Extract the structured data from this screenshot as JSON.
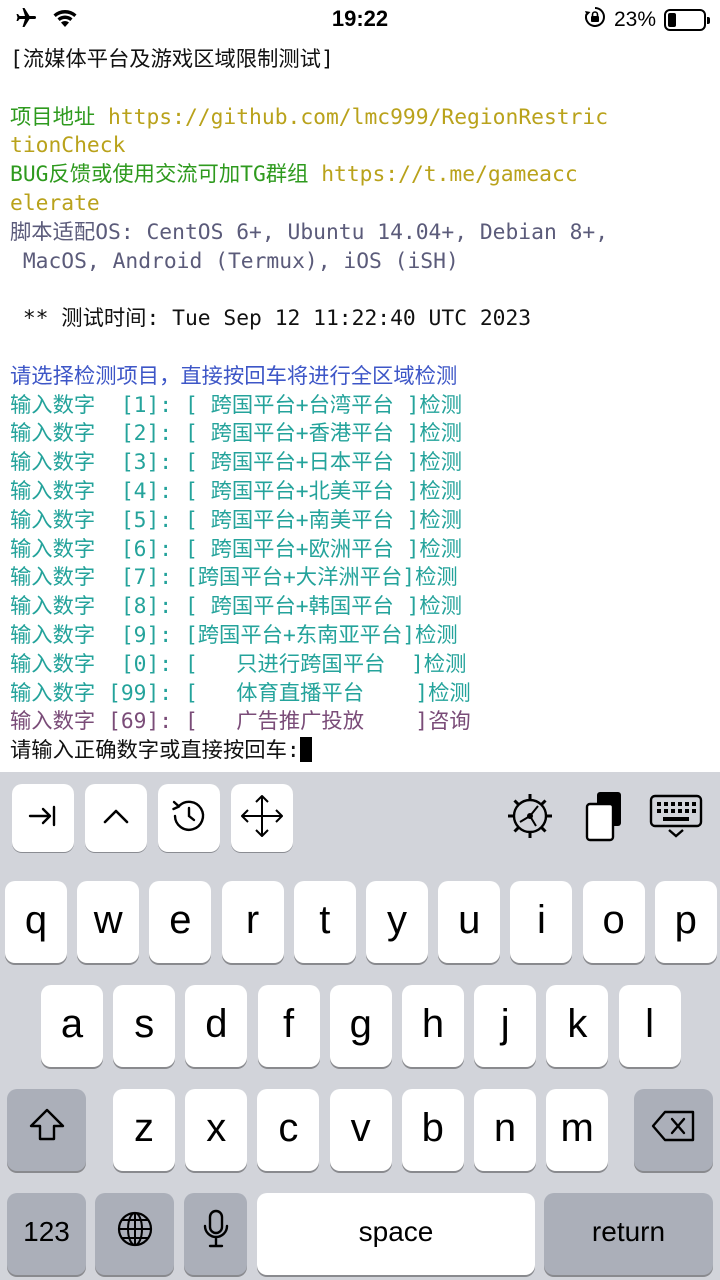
{
  "status_bar": {
    "time": "19:22",
    "battery_percent": "23%",
    "battery_level": 0.23,
    "icons": [
      "airplane-icon",
      "wifi-icon",
      "rotation-lock-icon",
      "battery-icon"
    ]
  },
  "terminal": {
    "lines": [
      {
        "segments": [
          {
            "text": "[流媒体平台及游戏区域限制测试]",
            "color": "black"
          }
        ]
      },
      {
        "segments": [
          {
            "text": "",
            "color": "black"
          }
        ]
      },
      {
        "segments": [
          {
            "text": "项目地址 ",
            "color": "green"
          },
          {
            "text": "https://github.com/lmc999/RegionRestric",
            "color": "yellow"
          }
        ]
      },
      {
        "segments": [
          {
            "text": "tionCheck",
            "color": "yellow"
          }
        ]
      },
      {
        "segments": [
          {
            "text": "BUG反馈或使用交流可加TG群组 ",
            "color": "green"
          },
          {
            "text": "https://t.me/gameacc",
            "color": "yellow"
          }
        ]
      },
      {
        "segments": [
          {
            "text": "elerate",
            "color": "yellow"
          }
        ]
      },
      {
        "segments": [
          {
            "text": "脚本适配OS: CentOS 6+, Ubuntu 14.04+, Debian 8+,",
            "color": "grey"
          }
        ]
      },
      {
        "segments": [
          {
            "text": " MacOS, Android (Termux), iOS (iSH)",
            "color": "grey"
          }
        ]
      },
      {
        "segments": [
          {
            "text": "",
            "color": "black"
          }
        ]
      },
      {
        "segments": [
          {
            "text": " ** 测试时间: Tue Sep 12 11:22:40 UTC 2023",
            "color": "black"
          }
        ]
      },
      {
        "segments": [
          {
            "text": "",
            "color": "black"
          }
        ]
      },
      {
        "segments": [
          {
            "text": "请选择检测项目，直接按回车将进行全区域检测",
            "color": "blue"
          }
        ]
      },
      {
        "segments": [
          {
            "text": "输入数字  [1]: [ 跨国平台+台湾平台 ]检测",
            "color": "teal"
          }
        ]
      },
      {
        "segments": [
          {
            "text": "输入数字  [2]: [ 跨国平台+香港平台 ]检测",
            "color": "teal"
          }
        ]
      },
      {
        "segments": [
          {
            "text": "输入数字  [3]: [ 跨国平台+日本平台 ]检测",
            "color": "teal"
          }
        ]
      },
      {
        "segments": [
          {
            "text": "输入数字  [4]: [ 跨国平台+北美平台 ]检测",
            "color": "teal"
          }
        ]
      },
      {
        "segments": [
          {
            "text": "输入数字  [5]: [ 跨国平台+南美平台 ]检测",
            "color": "teal"
          }
        ]
      },
      {
        "segments": [
          {
            "text": "输入数字  [6]: [ 跨国平台+欧洲平台 ]检测",
            "color": "teal"
          }
        ]
      },
      {
        "segments": [
          {
            "text": "输入数字  [7]: [跨国平台+大洋洲平台]检测",
            "color": "teal"
          }
        ]
      },
      {
        "segments": [
          {
            "text": "输入数字  [8]: [ 跨国平台+韩国平台 ]检测",
            "color": "teal"
          }
        ]
      },
      {
        "segments": [
          {
            "text": "输入数字  [9]: [跨国平台+东南亚平台]检测",
            "color": "teal"
          }
        ]
      },
      {
        "segments": [
          {
            "text": "输入数字  [0]: [   只进行跨国平台  ]检测",
            "color": "teal"
          }
        ]
      },
      {
        "segments": [
          {
            "text": "输入数字 [99]: [   体育直播平台    ]检测",
            "color": "teal"
          }
        ]
      },
      {
        "segments": [
          {
            "text": "输入数字 [69]: [   广告推广投放    ]咨询",
            "color": "purple"
          }
        ]
      },
      {
        "segments": [
          {
            "text": "请输入正确数字或直接按回车:",
            "color": "black"
          }
        ],
        "cursor": true
      }
    ]
  },
  "colors": {
    "black": "#111111",
    "green": "#2e9a1e",
    "yellow": "#b9a21b",
    "grey": "#5b5b7a",
    "blue": "#3d56c7",
    "teal": "#24a39b",
    "purple": "#7a4c78",
    "keyboard_bg": "#d2d4da",
    "key_light": "#ffffff",
    "key_dark": "#abafb9"
  },
  "toolbar": {
    "buttons": [
      "tab-key-icon",
      "control-key-icon",
      "history-icon",
      "arrow-keys-icon"
    ],
    "right_icons": [
      "settings-gear-icon",
      "clipboard-icon",
      "keyboard-dismiss-icon"
    ]
  },
  "keyboard": {
    "row1": [
      "q",
      "w",
      "e",
      "r",
      "t",
      "y",
      "u",
      "i",
      "o",
      "p"
    ],
    "row2": [
      "a",
      "s",
      "d",
      "f",
      "g",
      "h",
      "j",
      "k",
      "l"
    ],
    "row3": [
      "z",
      "x",
      "c",
      "v",
      "b",
      "n",
      "m"
    ],
    "numbers_label": "123",
    "space_label": "space",
    "return_label": "return"
  }
}
